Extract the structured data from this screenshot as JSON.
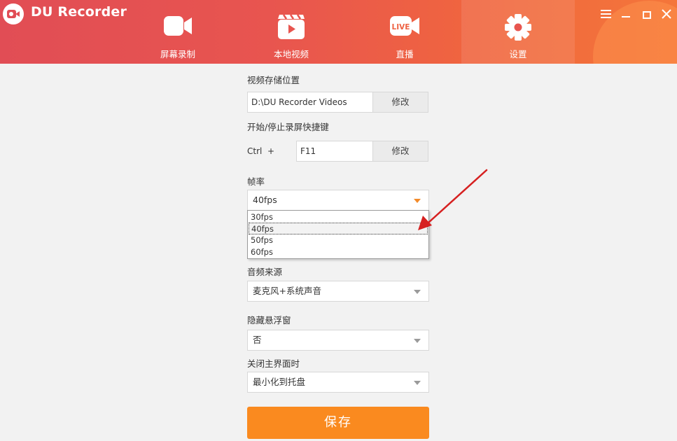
{
  "app": {
    "title": "DU Recorder"
  },
  "nav": [
    {
      "label": "屏幕录制",
      "icon": "video-camera-icon"
    },
    {
      "label": "本地视频",
      "icon": "clapperboard-icon"
    },
    {
      "label": "直播",
      "icon": "live-icon",
      "icon_text": "LIVE"
    },
    {
      "label": "设置",
      "icon": "gear-icon",
      "active": true
    }
  ],
  "settings": {
    "storage_label": "视频存储位置",
    "storage_path": "D:\\DU Recorder Videos",
    "modify_label": "修改",
    "hotkey_label": "开始/停止录屏快捷键",
    "hotkey_modifier": "Ctrl  +",
    "hotkey_key": "F11",
    "fps_label": "帧率",
    "fps_value": "40fps",
    "fps_options": [
      "30fps",
      "40fps",
      "50fps",
      "60fps"
    ],
    "audio_label": "音频来源",
    "audio_value": "麦克风+系统声音",
    "float_label": "隐藏悬浮窗",
    "float_value": "否",
    "close_label": "关闭主界面时",
    "close_value": "最小化到托盘",
    "save_label": "保存"
  },
  "colors": {
    "header_start": "#e14d55",
    "header_end": "#f4763a",
    "save_button": "#fa8a1f",
    "annotation_arrow": "#d62020"
  }
}
